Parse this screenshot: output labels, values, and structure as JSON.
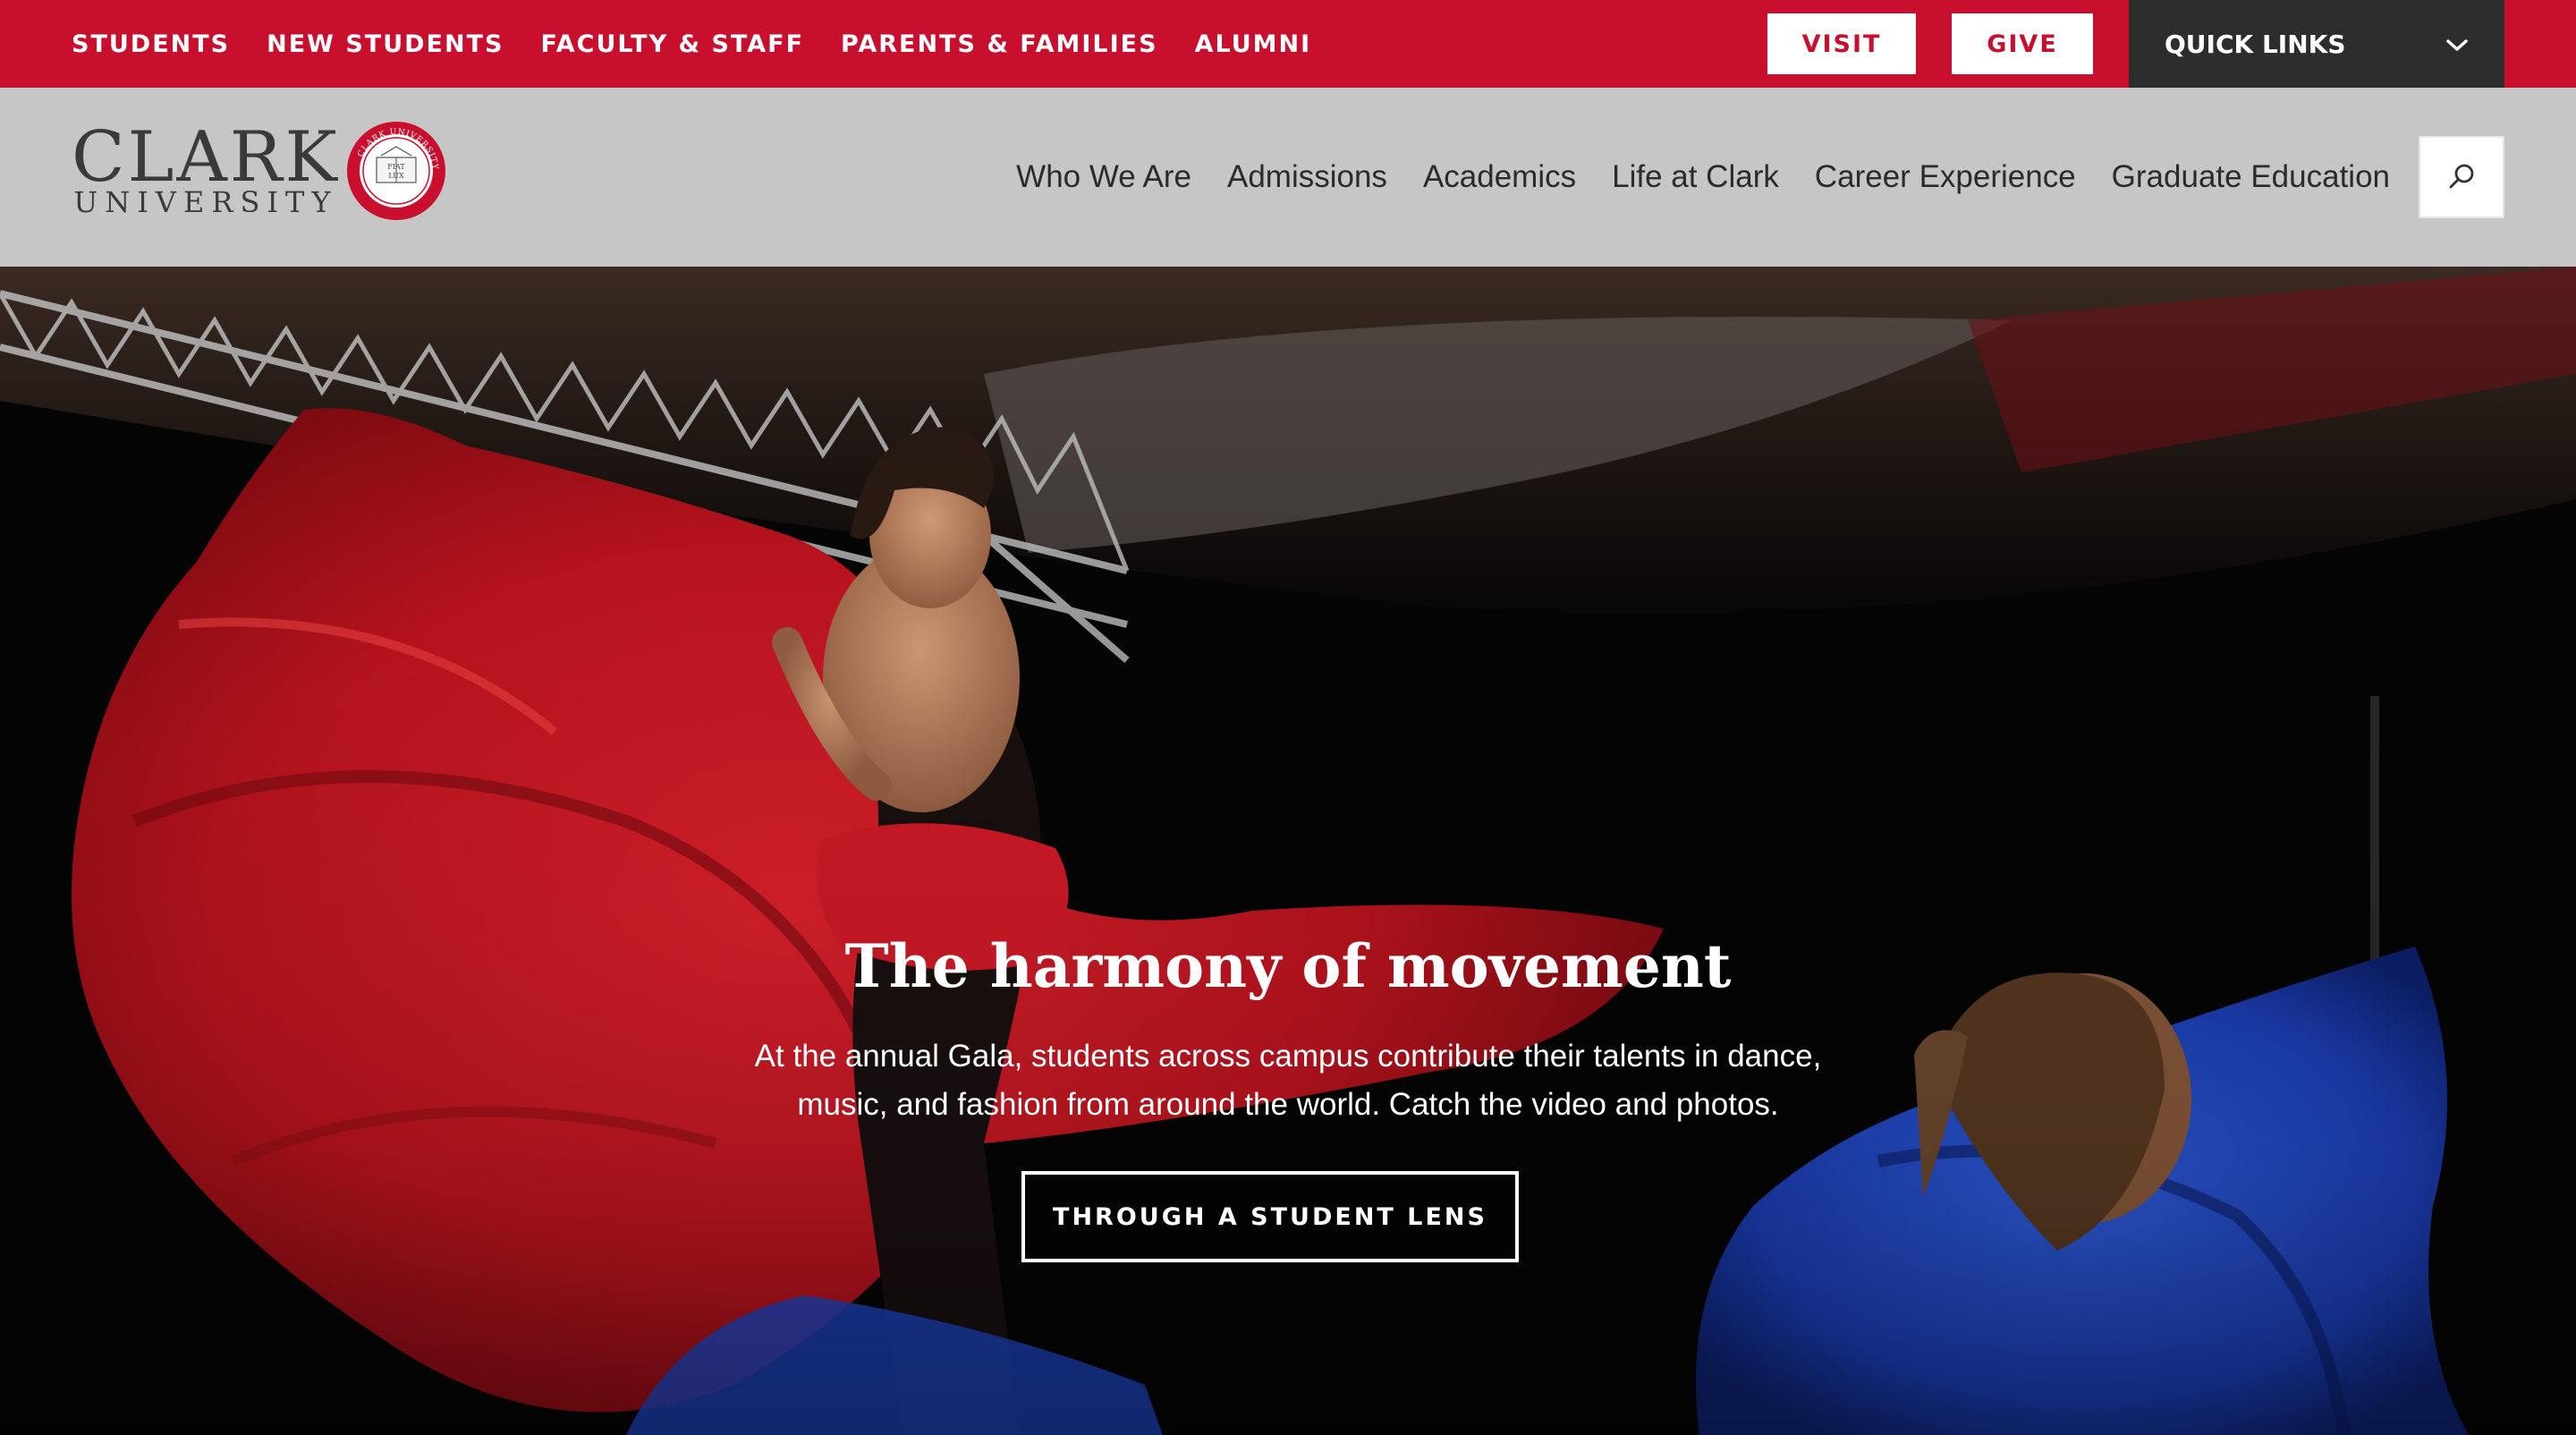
{
  "utility": {
    "audience_links": [
      "STUDENTS",
      "NEW STUDENTS",
      "FACULTY & STAFF",
      "PARENTS & FAMILIES",
      "ALUMNI"
    ],
    "visit_label": "VISIT",
    "give_label": "GIVE",
    "quick_links_label": "QUICK LINKS",
    "quick_links_icon": "chevron-down-icon"
  },
  "header": {
    "logo": {
      "wordmark": "CLARK",
      "subwordmark": "UNIVERSITY",
      "seal_text": "CLARK UNIVERSITY",
      "seal_motto": "FIAT LUX",
      "seal_year": "MDCCCLXXXVII"
    },
    "nav": [
      "Who We Are",
      "Admissions",
      "Academics",
      "Life at Clark",
      "Career Experience",
      "Graduate Education"
    ],
    "search_icon": "search-icon"
  },
  "hero": {
    "title": "The harmony of movement",
    "description": "At the annual Gala, students across campus contribute their talents in dance, music, and fashion from around the world. Catch the video and photos.",
    "cta_label": "THROUGH A STUDENT LENS"
  },
  "colors": {
    "brand_red": "#c8102e",
    "quick_links_bg": "#2d2d2d",
    "header_bg": "#c6c6c6"
  }
}
